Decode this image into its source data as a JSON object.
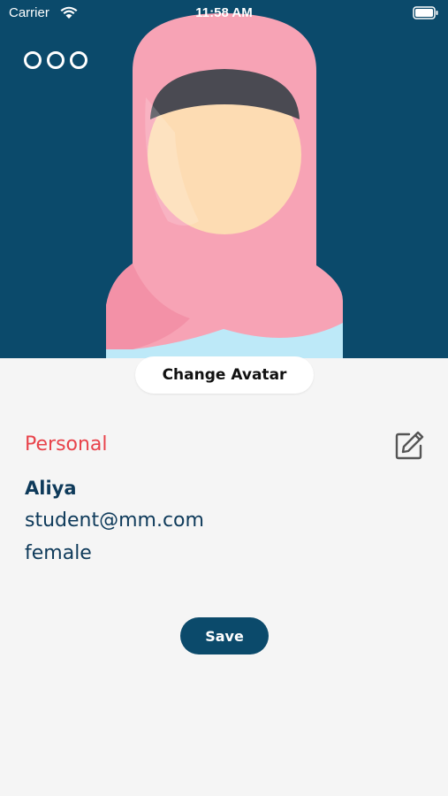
{
  "status_bar": {
    "carrier": "Carrier",
    "time": "11:58 AM"
  },
  "header": {
    "menu_icon": "more-options-icon",
    "avatar_icon": "hijab-avatar-icon",
    "change_avatar_label": "Change Avatar"
  },
  "profile": {
    "section_title": "Personal",
    "edit_icon": "edit-icon",
    "name": "Aliya",
    "email": "student@mm.com",
    "gender": "female"
  },
  "actions": {
    "save_label": "Save"
  },
  "colors": {
    "header_bg": "#0b4a6b",
    "accent_red": "#e8434b",
    "text_primary": "#0e3a5a",
    "page_bg": "#f5f5f5",
    "button_bg": "#0b4a6b"
  }
}
